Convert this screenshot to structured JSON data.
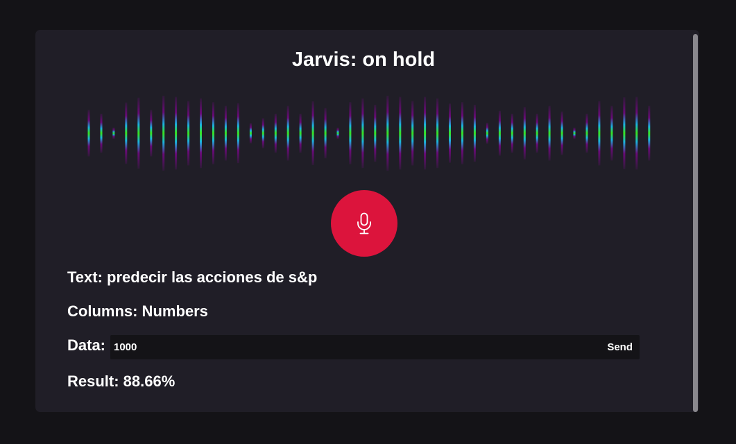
{
  "header": {
    "title": "Jarvis: on hold"
  },
  "waveform": {
    "bar_levels": [
      0.62,
      0.52,
      0.15,
      0.82,
      0.95,
      0.62,
      1.0,
      0.97,
      0.86,
      0.93,
      0.83,
      0.73,
      0.8,
      0.27,
      0.4,
      0.52,
      0.73,
      0.52,
      0.85,
      0.67,
      0.15,
      0.83,
      0.93,
      0.76,
      1.0,
      0.97,
      0.86,
      0.97,
      0.93,
      0.79,
      0.83,
      0.76,
      0.28,
      0.6,
      0.52,
      0.7,
      0.52,
      0.73,
      0.58,
      0.15,
      0.52,
      0.86,
      0.73,
      0.96,
      0.97,
      0.73
    ],
    "colors": {
      "center": "#39e51a",
      "mid": "#19b4e0",
      "edge": "#6a0a79"
    }
  },
  "mic": {
    "icon": "microphone-icon",
    "color": "#dc143c"
  },
  "fields": {
    "text_label": "Text: predecir las acciones de s&p",
    "columns_label": "Columns: Numbers",
    "data_label": "Data:",
    "data_value": "1000",
    "send_label": "Send",
    "result_label": "Result: 88.66%"
  }
}
